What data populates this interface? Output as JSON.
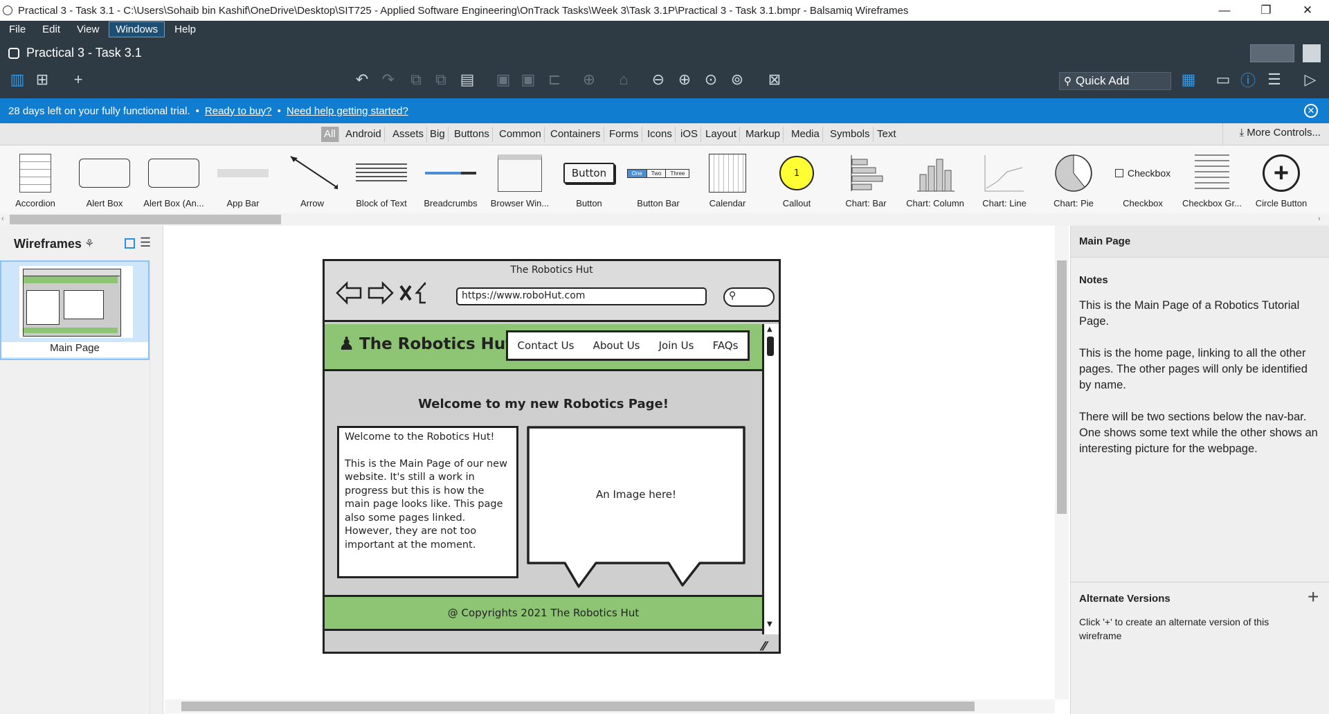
{
  "window": {
    "title": "Practical 3 - Task 3.1 - C:\\Users\\Sohaib bin Kashif\\OneDrive\\Desktop\\SIT725 - Applied Software Engineering\\OnTrack Tasks\\Week 3\\Task 3.1P\\Practical 3 - Task 3.1.bmpr - Balsamiq Wireframes",
    "minimize": "—",
    "restore": "❐",
    "close": "✕"
  },
  "menu": [
    "File",
    "Edit",
    "View",
    "Windows",
    "Help"
  ],
  "doc": {
    "title": "Practical 3 - Task 3.1"
  },
  "toolbar": {
    "quick_add": "Quick Add"
  },
  "trial": {
    "text": "28 days left on your fully functional trial.",
    "sep": "•",
    "buy": "Ready to buy?",
    "help": "Need help getting started?"
  },
  "categories": [
    "All",
    "Android",
    "Assets",
    "Big",
    "Buttons",
    "Common",
    "Containers",
    "Forms",
    "Icons",
    "iOS",
    "Layout",
    "Markup",
    "Media",
    "Symbols",
    "Text"
  ],
  "more_controls": "More Controls...",
  "library": [
    {
      "label": "Accordion"
    },
    {
      "label": "Alert Box"
    },
    {
      "label": "Alert Box (An..."
    },
    {
      "label": "App Bar"
    },
    {
      "label": "Arrow"
    },
    {
      "label": "Block of Text"
    },
    {
      "label": "Breadcrumbs"
    },
    {
      "label": "Browser Win..."
    },
    {
      "label": "Button",
      "inner": "Button"
    },
    {
      "label": "Button Bar",
      "inner": [
        "One",
        "Two",
        "Three"
      ]
    },
    {
      "label": "Calendar"
    },
    {
      "label": "Callout",
      "inner": "1"
    },
    {
      "label": "Chart: Bar"
    },
    {
      "label": "Chart: Column"
    },
    {
      "label": "Chart: Line"
    },
    {
      "label": "Chart: Pie"
    },
    {
      "label": "Checkbox",
      "inner": "Checkbox"
    },
    {
      "label": "Checkbox Gr..."
    },
    {
      "label": "Circle Button"
    }
  ],
  "left": {
    "title": "Wireframes",
    "page": "Main Page"
  },
  "mock": {
    "browser_title": "The Robotics Hut",
    "url": "https://www.roboHut.com",
    "brand": "The Robotics Hut",
    "nav": [
      "Contact Us",
      "About Us",
      "Join Us",
      "FAQs"
    ],
    "heading": "Welcome to my new Robotics Page!",
    "text_title": "Welcome to the Robotics Hut!",
    "text_body": "This is the Main Page of our new website. It's still a work in progress but this is how the main page looks like. This page also some pages linked. However, they are not too important at the moment.",
    "image_text": "An Image here!",
    "footer": "@ Copyrights 2021 The Robotics Hut"
  },
  "right": {
    "page": "Main Page",
    "notes_label": "Notes",
    "notes": [
      "This is the Main Page of a Robotics Tutorial Page.",
      "This is the home page, linking to all the other pages. The other pages will only be identified by name.",
      "There will be two sections below the nav-bar. One shows some text while the other shows an interesting picture for the webpage."
    ],
    "alt_label": "Alternate Versions",
    "alt_text": "Click '+' to create an alternate version of this wireframe"
  }
}
